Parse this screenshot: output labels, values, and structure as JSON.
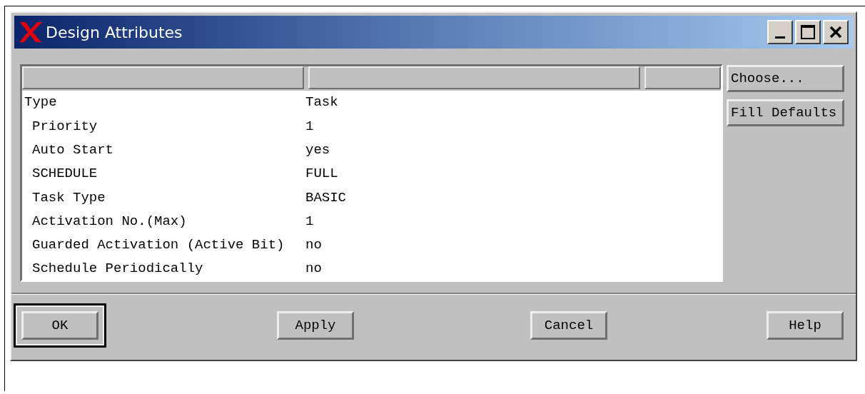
{
  "window": {
    "title": "Design Attributes"
  },
  "attributes": {
    "rows": [
      {
        "label": "Type",
        "value": "Task",
        "children": [
          {
            "label": "Priority",
            "value": "1"
          },
          {
            "label": "Auto Start",
            "value": "yes"
          },
          {
            "label": "SCHEDULE",
            "value": "FULL"
          },
          {
            "label": "Task Type",
            "value": "BASIC"
          },
          {
            "label": "Activation No.(Max)",
            "value": "1"
          },
          {
            "label": "Guarded Activation (Active Bit)",
            "value": "no"
          },
          {
            "label": "Schedule Periodically",
            "value": "no"
          }
        ]
      }
    ]
  },
  "side_buttons": [
    "Choose...",
    "Fill Defaults"
  ],
  "buttons": [
    {
      "label": "OK",
      "default": true
    },
    {
      "label": "Apply",
      "default": false
    },
    {
      "label": "Cancel",
      "default": false
    },
    {
      "label": "Help",
      "default": false
    }
  ]
}
